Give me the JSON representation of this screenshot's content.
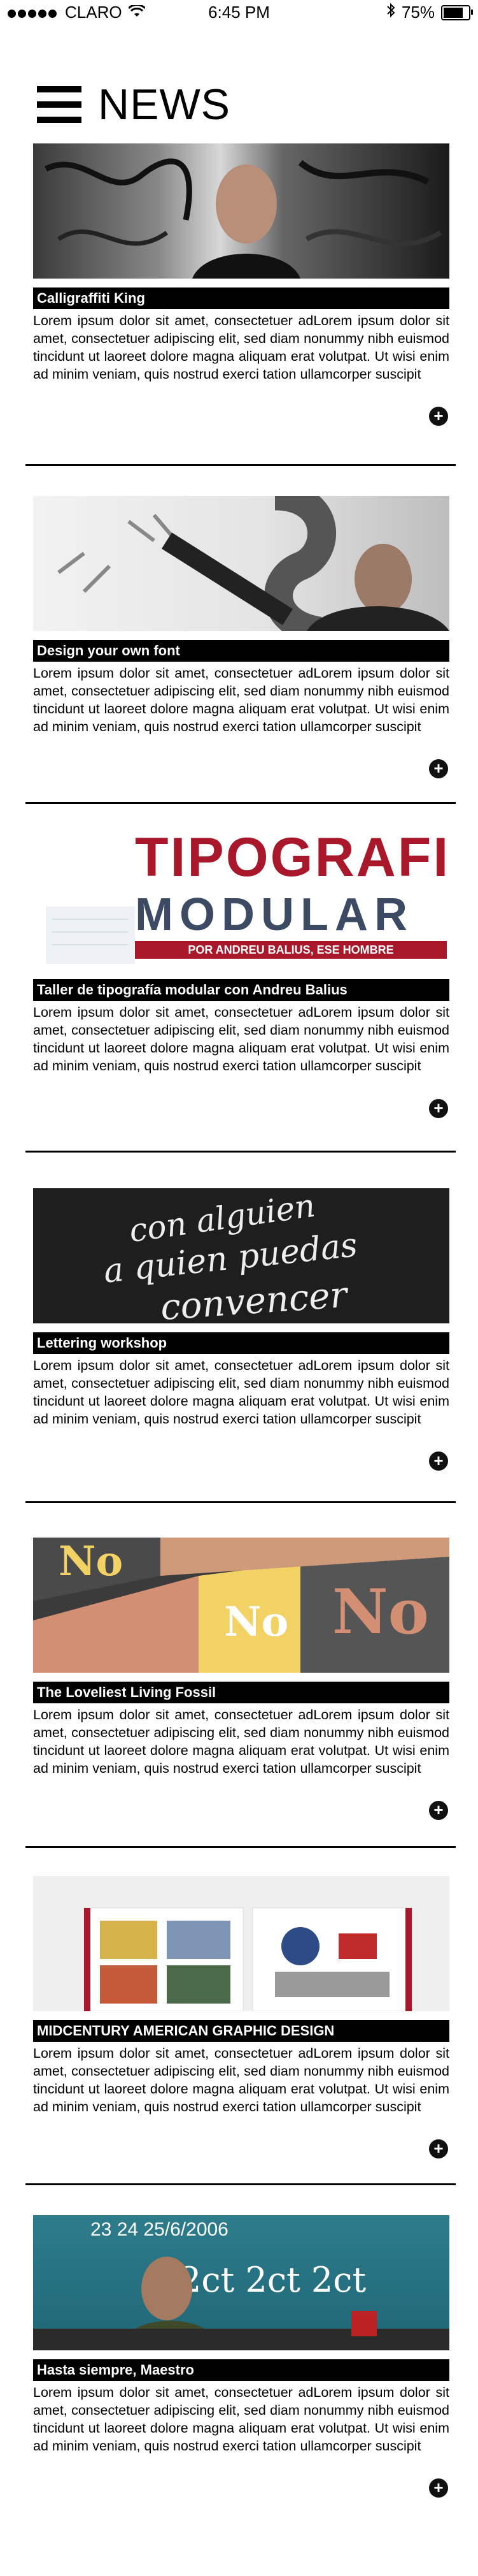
{
  "status": {
    "carrier": "CLARO",
    "time": "6:45 PM",
    "battery": "75%"
  },
  "header": {
    "title": "NEWS"
  },
  "body_text": "Lorem ipsum dolor sit amet, consectetuer adLorem ipsum dolor sit amet, consectetuer adipiscing elit, sed diam nonummy nibh euismod tincidunt ut laoreet dolore magna aliquam erat volutpat. Ut wisi enim ad minim veniam, quis nostrud exerci tation ullamcorper suscipit",
  "articles": [
    {
      "title": "Calligraffiti King"
    },
    {
      "title": "Design your own font"
    },
    {
      "title": "Taller de tipografía modular con Andreu Balius",
      "image_text": [
        "TIPOGRAFIA",
        "MODULAR",
        "POR ANDREU BALIUS, ESE HOMBRE"
      ]
    },
    {
      "title": "Lettering workshop",
      "image_text": [
        "con alguien",
        "a quien puedas",
        "convencer"
      ]
    },
    {
      "title": "The Loveliest Living Fossil",
      "image_text": [
        "No",
        "No",
        "No"
      ]
    },
    {
      "title": "MIDCENTURY AMERICAN GRAPHIC DESIGN"
    },
    {
      "title": "Hasta siempre, Maestro",
      "image_text": [
        "23 24 25/6/2006",
        "2ct 2ct 2ct"
      ]
    }
  ],
  "plus_label": "+",
  "colors": {
    "accent_red": "#a8182a",
    "black": "#000000"
  }
}
